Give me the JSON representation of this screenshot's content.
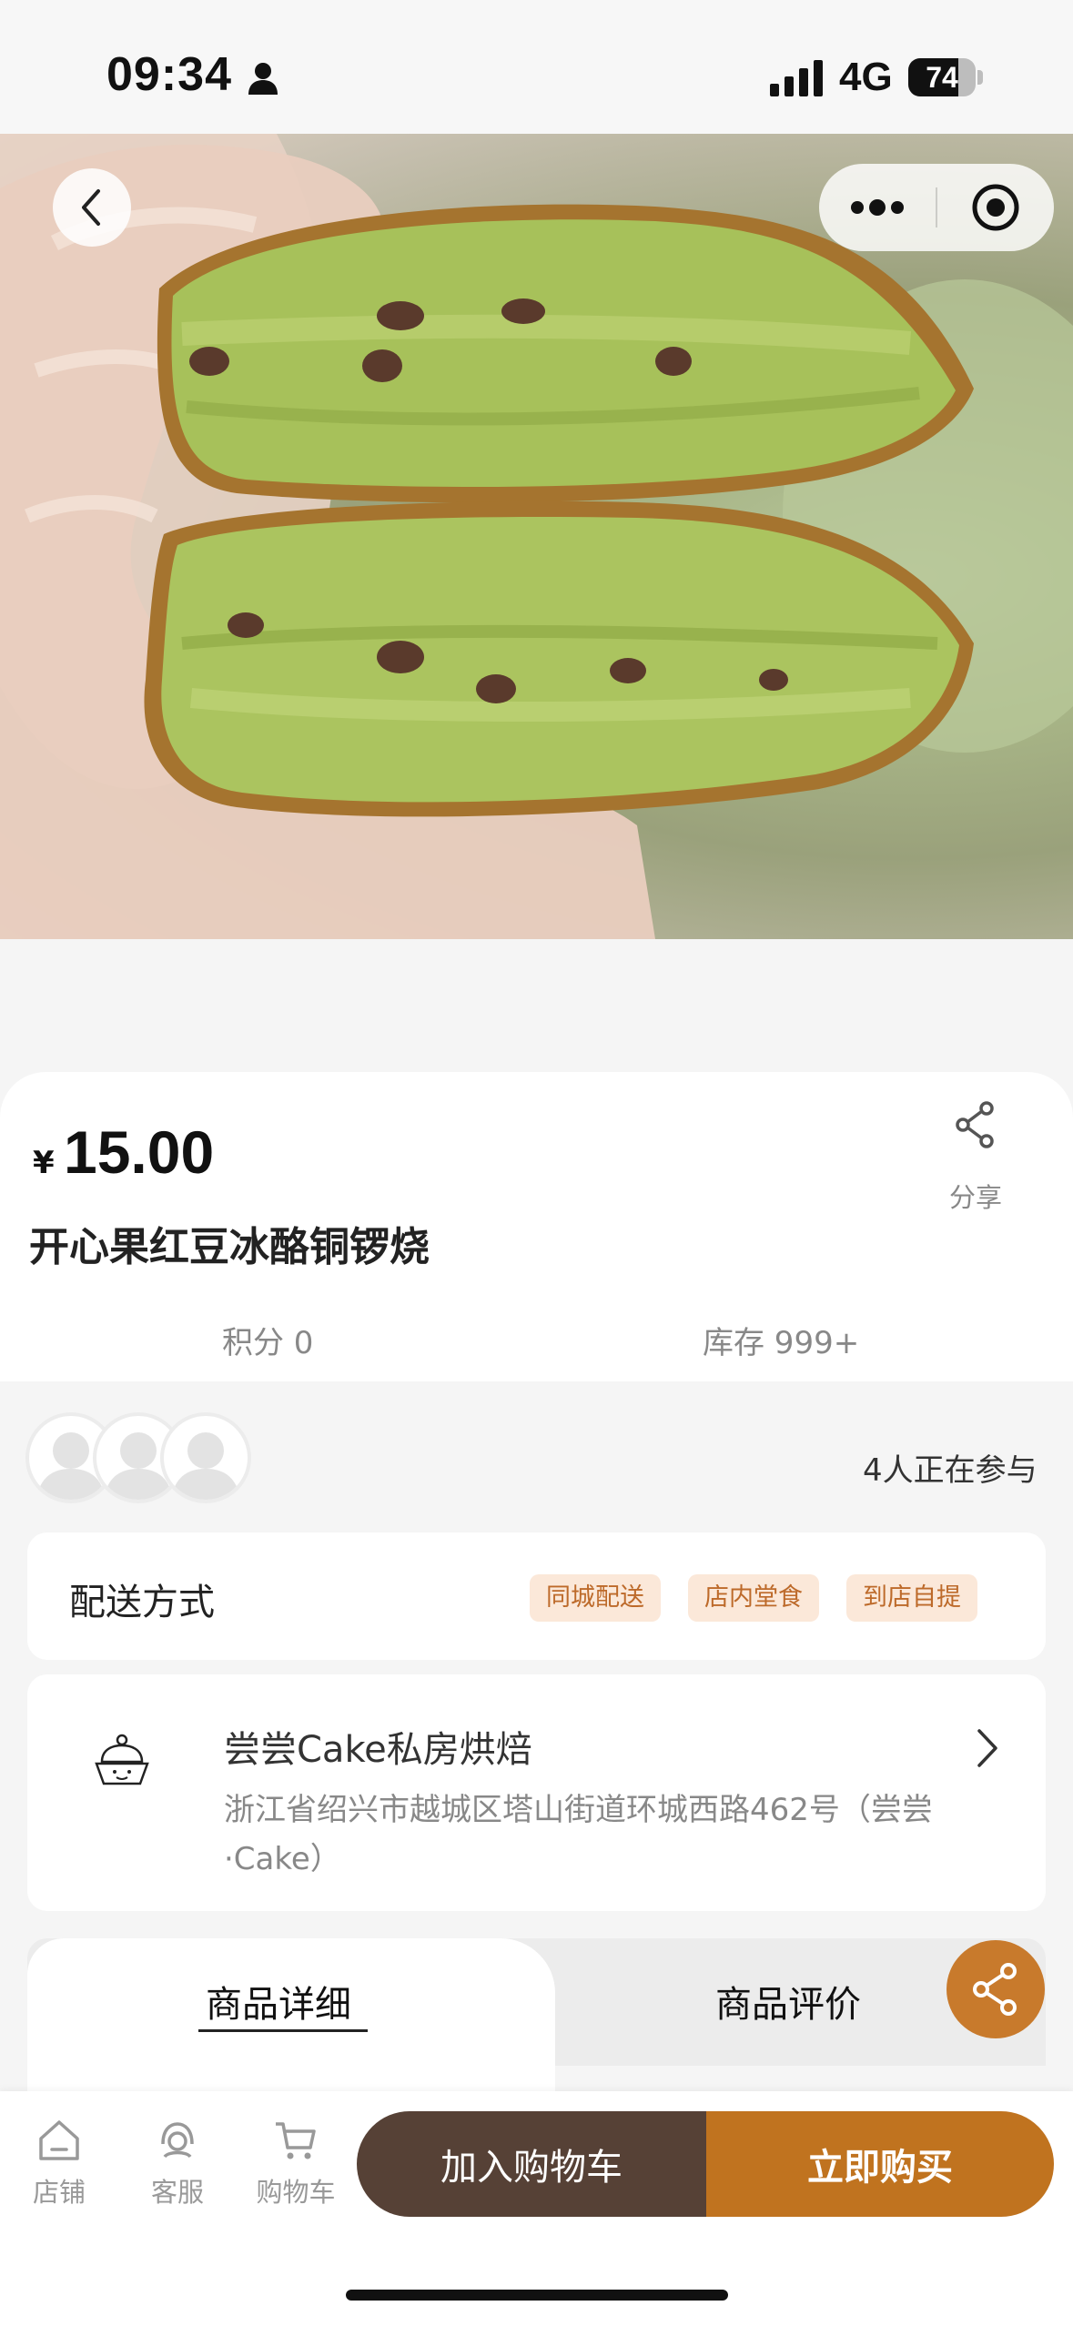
{
  "status_bar": {
    "time": "09:34",
    "network": "4G",
    "battery": "74",
    "battery_level": 0.74
  },
  "product": {
    "currency": "¥",
    "price": "15.00",
    "name": "开心果红豆冰酪铜锣烧",
    "points": "积分 0",
    "stock": "库存 999+",
    "share_label": "分享"
  },
  "participants": {
    "text": "4人正在参与"
  },
  "delivery": {
    "label": "配送方式",
    "tags": [
      "同城配送",
      "店内堂食",
      "到店自提"
    ]
  },
  "store": {
    "name": "尝尝Cake私房烘焙",
    "address": "浙江省绍兴市越城区塔山街道环城西路462号（尝尝·Cake）",
    "logo_text": "尝尝·Cake"
  },
  "tabs": [
    {
      "label": "商品详细",
      "active": true
    },
    {
      "label": "商品评价",
      "active": false
    }
  ],
  "bottom_nav": [
    {
      "label": "店铺",
      "icon": "shop-icon"
    },
    {
      "label": "客服",
      "icon": "customer-service-icon"
    },
    {
      "label": "购物车",
      "icon": "cart-icon"
    }
  ],
  "actions": {
    "add_to_cart": "加入购物车",
    "buy_now": "立即购买"
  },
  "colors": {
    "accent": "#c0731f",
    "cart_button": "#564136",
    "tag_bg": "#fbe8d9",
    "tag_text": "#bd6a2a"
  }
}
